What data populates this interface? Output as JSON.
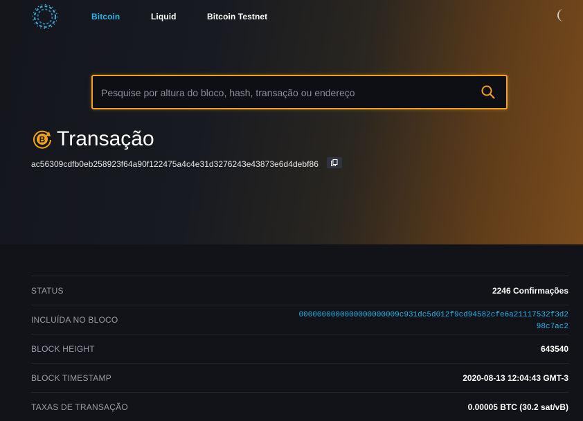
{
  "header": {
    "nav": [
      {
        "label": "Bitcoin",
        "active": true
      },
      {
        "label": "Liquid",
        "active": false
      },
      {
        "label": "Bitcoin Testnet",
        "active": false
      }
    ]
  },
  "search": {
    "placeholder": "Pesquise por altura do bloco, hash, transação ou endereço",
    "value": ""
  },
  "transaction": {
    "title": "Transação",
    "txid": "ac56309cdfb0eb258923f64a90f122475a4c4e31d3276243e43873e6d4debf86"
  },
  "details": [
    {
      "label": "STATUS",
      "value": "2246 Confirmações"
    },
    {
      "label": "INCLUÍDA NO BLOCO",
      "value": "0000000000000000000009c931dc5d012f9cd94582cfe6a21117532f3d298c7ac2"
    },
    {
      "label": "BLOCK HEIGHT",
      "value": "643540"
    },
    {
      "label": "BLOCK TIMESTAMP",
      "value": "2020-08-13 12:04:43 GMT-3"
    },
    {
      "label": "TAXAS DE TRANSAÇÃO",
      "value": "0.00005 BTC (30.2 sat/vB)"
    }
  ],
  "colors": {
    "accent": "#24b4e8",
    "search_border": "#f0a21b",
    "icon_orange": "#f0a21b"
  },
  "icons": [
    "blockstream-logo-icon",
    "moon-icon",
    "search-icon",
    "bitcoin-transaction-icon",
    "copy-icon"
  ]
}
